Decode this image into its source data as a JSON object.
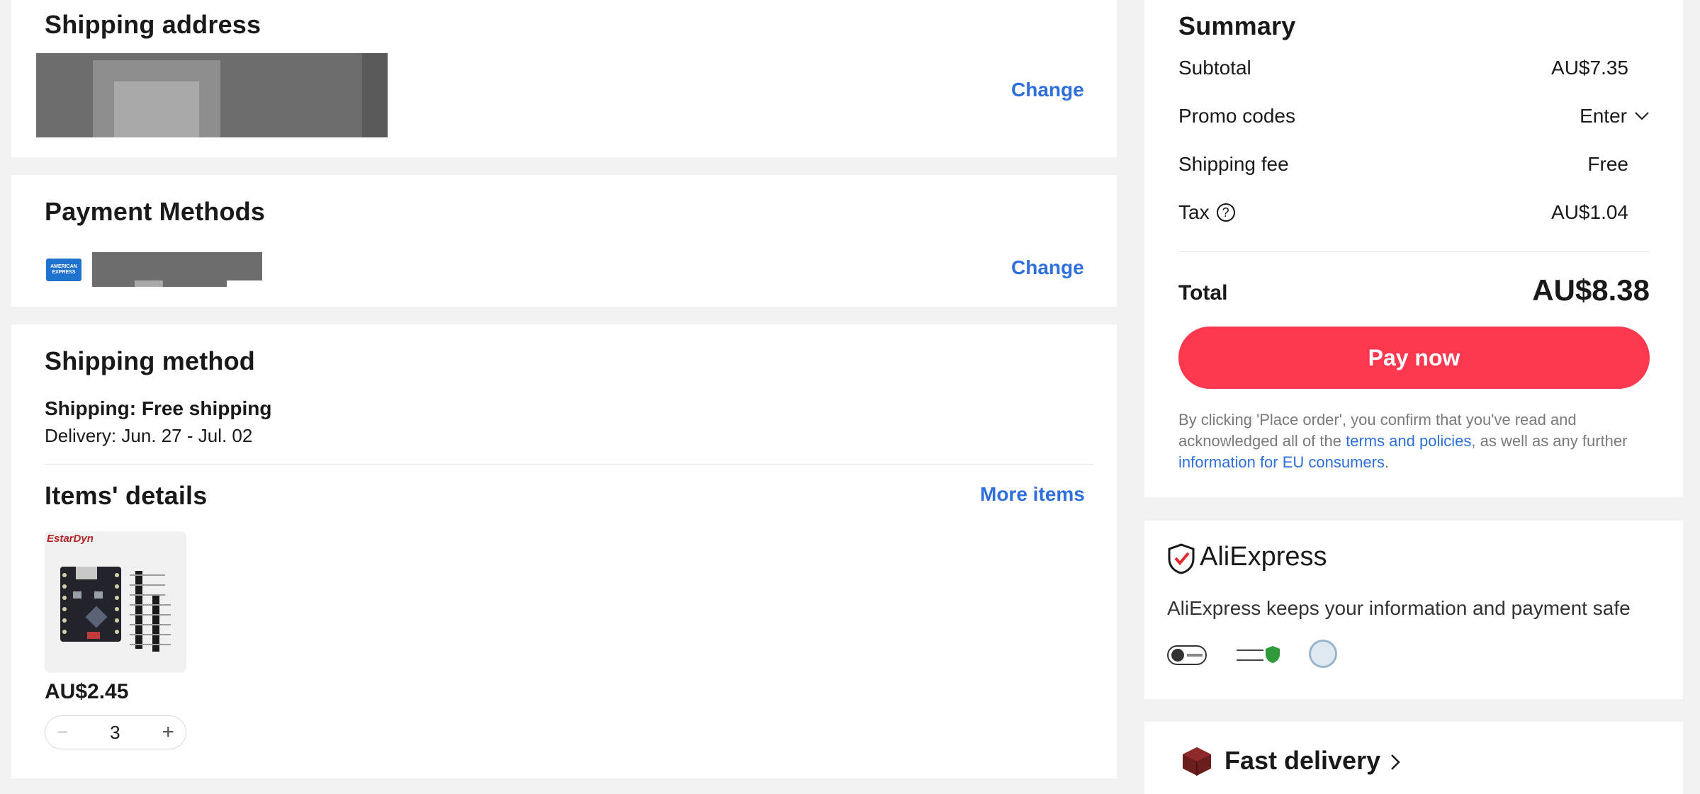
{
  "shipping_address": {
    "title": "Shipping address",
    "change_label": "Change"
  },
  "payment_methods": {
    "title": "Payment Methods",
    "change_label": "Change",
    "card_logo_text": "AMERICAN EXPRESS"
  },
  "shipping_method": {
    "title": "Shipping method",
    "shipping_line": "Shipping: Free shipping",
    "delivery_line": "Delivery: Jun. 27 - Jul. 02"
  },
  "items_details": {
    "title": "Items' details",
    "more_items_label": "More items",
    "item": {
      "brand": "EstarDyn",
      "price": "AU$2.45",
      "quantity": "3"
    }
  },
  "summary": {
    "title": "Summary",
    "subtotal_label": "Subtotal",
    "subtotal_value": "AU$7.35",
    "promo_label": "Promo codes",
    "promo_value": "Enter",
    "shipping_fee_label": "Shipping fee",
    "shipping_fee_value": "Free",
    "tax_label": "Tax",
    "tax_value": "AU$1.04",
    "total_label": "Total",
    "total_value": "AU$8.38",
    "pay_label": "Pay now",
    "legal_prefix": "By clicking 'Place order', you confirm that you've read and acknowledged all of the ",
    "legal_link1": "terms and policies",
    "legal_mid": ", as well as any further ",
    "legal_link2": "information for EU consumers",
    "legal_suffix": "."
  },
  "security": {
    "brand": "AliExpress",
    "message": "AliExpress keeps your information and payment safe"
  },
  "fast_delivery": {
    "title": "Fast delivery"
  },
  "colors": {
    "accent_link": "#2e6fdb",
    "pay_button": "#fd384f",
    "amex_blue": "#1f72cd"
  }
}
